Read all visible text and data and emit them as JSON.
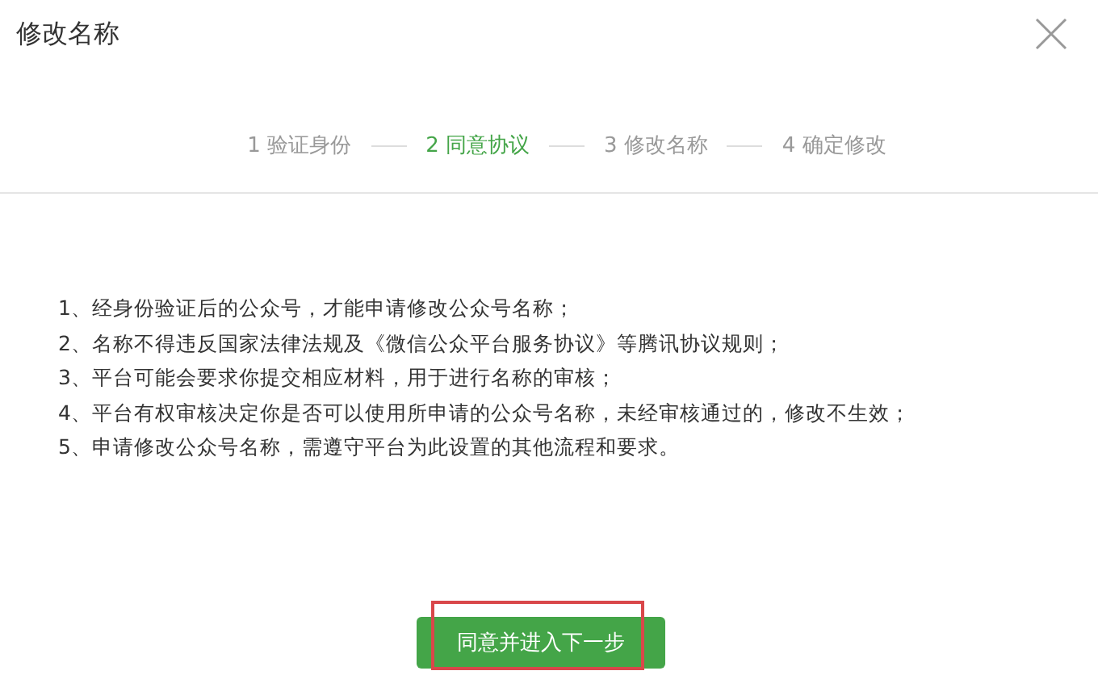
{
  "dialog": {
    "title": "修改名称",
    "closable": true
  },
  "steps": [
    {
      "number": "1",
      "label": "验证身份",
      "selected": false
    },
    {
      "number": "2",
      "label": "同意协议",
      "selected": true
    },
    {
      "number": "3",
      "label": "修改名称",
      "selected": false
    },
    {
      "number": "4",
      "label": "确定修改",
      "selected": false
    }
  ],
  "terms": [
    "1、经身份验证后的公众号，才能申请修改公众号名称；",
    "2、名称不得违反国家法律法规及《微信公众平台服务协议》等腾讯协议规则；",
    "3、平台可能会要求你提交相应材料，用于进行名称的审核；",
    "4、平台有权审核决定你是否可以使用所申请的公众号名称，未经审核通过的，修改不生效；",
    "5、申请修改公众号名称，需遵守平台为此设置的其他流程和要求。"
  ],
  "button": {
    "label": "同意并进入下一步",
    "highlighted": true
  }
}
